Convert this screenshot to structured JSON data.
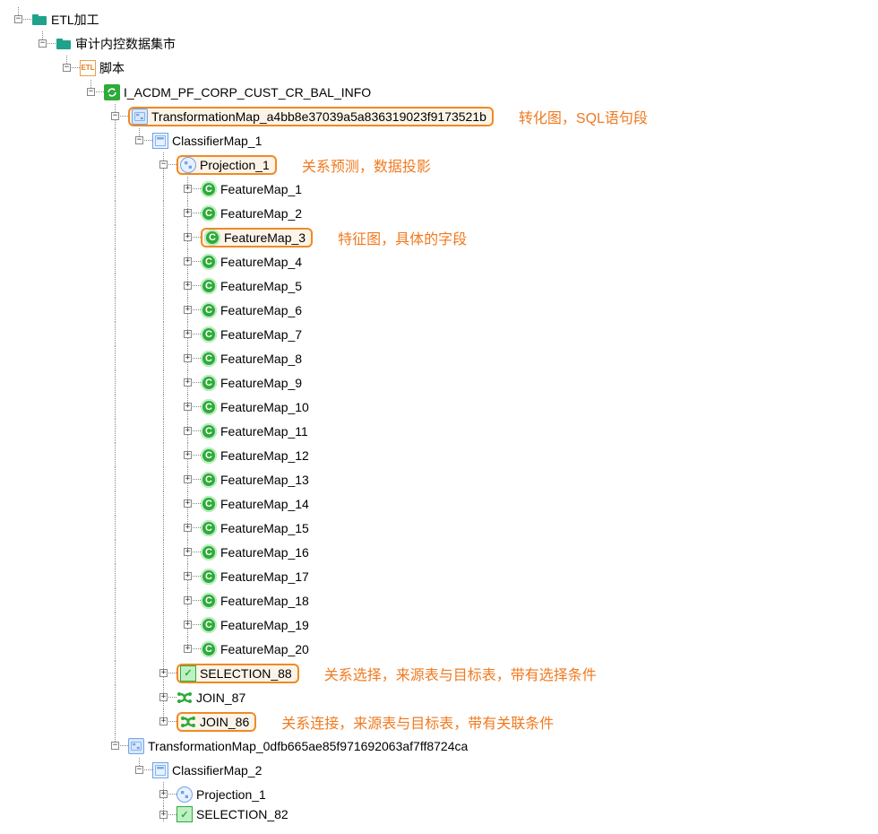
{
  "tree": {
    "root": "ETL加工",
    "datamart": "审计内控数据集市",
    "script": "脚本",
    "job": "I_ACDM_PF_CORP_CUST_CR_BAL_INFO",
    "transmap1": "TransformationMap_a4bb8e37039a5a836319023f9173521b",
    "classifier1": "ClassifierMap_1",
    "projection1": "Projection_1",
    "features": [
      "FeatureMap_1",
      "FeatureMap_2",
      "FeatureMap_3",
      "FeatureMap_4",
      "FeatureMap_5",
      "FeatureMap_6",
      "FeatureMap_7",
      "FeatureMap_8",
      "FeatureMap_9",
      "FeatureMap_10",
      "FeatureMap_11",
      "FeatureMap_12",
      "FeatureMap_13",
      "FeatureMap_14",
      "FeatureMap_15",
      "FeatureMap_16",
      "FeatureMap_17",
      "FeatureMap_18",
      "FeatureMap_19",
      "FeatureMap_20"
    ],
    "selection88": "SELECTION_88",
    "join87": "JOIN_87",
    "join86": "JOIN_86",
    "transmap2": "TransformationMap_0dfb665ae85f971692063af7ff8724ca",
    "classifier2": "ClassifierMap_2",
    "projection2": "Projection_1",
    "selection82": "SELECTION_82"
  },
  "annotations": {
    "transmap": "转化图，SQL语句段",
    "projection": "关系预测，数据投影",
    "featuremap": "特征图，具体的字段",
    "selection": "关系选择，来源表与目标表，带有选择条件",
    "join": "关系连接，来源表与目标表，带有关联条件"
  },
  "icon_labels": {
    "etl": "ETL",
    "feature_glyph": "C"
  }
}
